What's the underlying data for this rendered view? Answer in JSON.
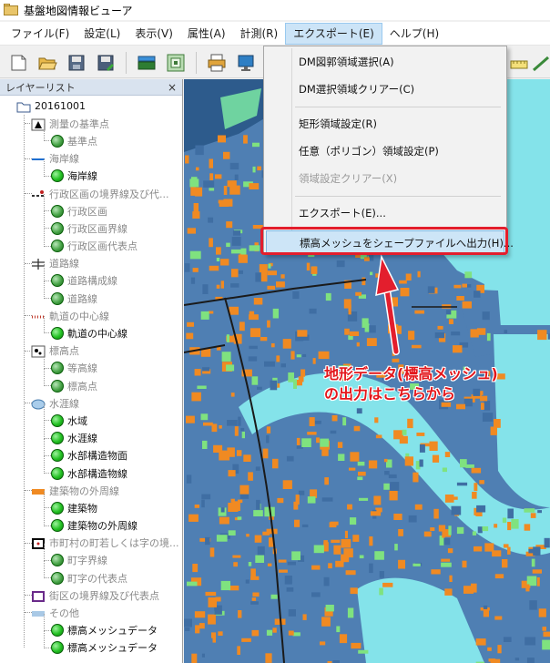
{
  "window": {
    "title": "基盤地図情報ビューア"
  },
  "menubar": {
    "items": [
      "ファイル(F)",
      "設定(L)",
      "表示(V)",
      "属性(A)",
      "計測(R)",
      "エクスポート(E)",
      "ヘルプ(H)"
    ],
    "open_index": 5
  },
  "export_menu": {
    "items": [
      {
        "label": "DM図郭領域選択(A)",
        "enabled": true
      },
      {
        "label": "DM選択領域クリアー(C)",
        "enabled": true
      },
      {
        "label": "矩形領域設定(R)",
        "enabled": true
      },
      {
        "label": "任意（ポリゴン）領域設定(P)",
        "enabled": true
      },
      {
        "label": "領域設定クリアー(X)",
        "enabled": false
      },
      {
        "label": "エクスポート(E)...",
        "enabled": true
      },
      {
        "label": "標高メッシュをシェープファイルへ出力(H)...",
        "enabled": true,
        "highlighted": true
      }
    ]
  },
  "layer_panel": {
    "title": "レイヤーリスト",
    "close_glyph": "×",
    "root": "20161001",
    "groups": [
      {
        "label": "測量の基準点",
        "icon": "triangle-point-icon",
        "children": [
          {
            "label": "基準点",
            "on": false
          }
        ]
      },
      {
        "label": "海岸線",
        "icon": "blue-line-icon",
        "children": [
          {
            "label": "海岸線",
            "on": true
          }
        ]
      },
      {
        "label": "行政区画の境界線及び代...",
        "icon": "boundary-line-icon",
        "children": [
          {
            "label": "行政区画",
            "on": false
          },
          {
            "label": "行政区画界線",
            "on": false
          },
          {
            "label": "行政区画代表点",
            "on": false
          }
        ]
      },
      {
        "label": "道路線",
        "icon": "road-icon",
        "children": [
          {
            "label": "道路構成線",
            "on": false
          },
          {
            "label": "道路線",
            "on": false
          }
        ]
      },
      {
        "label": "軌道の中心線",
        "icon": "railway-icon",
        "children": [
          {
            "label": "軌道の中心線",
            "on": true
          }
        ]
      },
      {
        "label": "標高点",
        "icon": "elevation-point-icon",
        "children": [
          {
            "label": "等高線",
            "on": false
          },
          {
            "label": "標高点",
            "on": false
          }
        ]
      },
      {
        "label": "水涯線",
        "icon": "water-icon",
        "children": [
          {
            "label": "水域",
            "on": true
          },
          {
            "label": "水涯線",
            "on": true
          },
          {
            "label": "水部構造物面",
            "on": true
          },
          {
            "label": "水部構造物線",
            "on": true
          }
        ]
      },
      {
        "label": "建築物の外周線",
        "icon": "building-icon",
        "children": [
          {
            "label": "建築物",
            "on": true
          },
          {
            "label": "建築物の外周線",
            "on": true
          }
        ]
      },
      {
        "label": "市町村の町若しくは字の境...",
        "icon": "town-boundary-icon",
        "children": [
          {
            "label": "町字界線",
            "on": false
          },
          {
            "label": "町字の代表点",
            "on": false
          }
        ]
      },
      {
        "label": "街区の境界線及び代表点",
        "icon": "block-boundary-icon",
        "children": []
      },
      {
        "label": "その他",
        "icon": "other-icon",
        "children": [
          {
            "label": "標高メッシュデータ",
            "on": true
          },
          {
            "label": "標高メッシュデータ",
            "on": true
          }
        ]
      }
    ]
  },
  "annotation": {
    "line1": "地形データ(標高メッシュ)",
    "line2": "の出力はこちらから",
    "color": "#e3161b"
  },
  "colors": {
    "map_water": "#84e3ea",
    "map_land": "#4f7fb3",
    "map_building": "#f08a22",
    "map_green": "#7fe27f",
    "menu_highlight": "#cde5f7",
    "callout_red": "#e31e2d"
  }
}
